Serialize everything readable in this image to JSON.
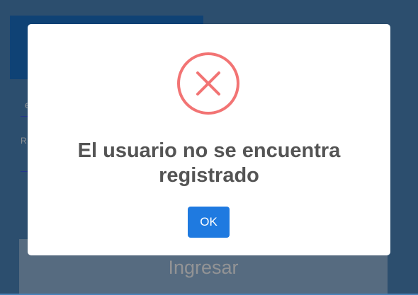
{
  "background_form": {
    "field1_partial_text": "e",
    "field2_partial_label": "R",
    "submit_label": "Ingresar"
  },
  "dialog": {
    "icon": "error-x-circle-icon",
    "icon_color": "#f27474",
    "title": "El usuario no se encuentra registrado",
    "ok_label": "OK",
    "ok_color": "#1f7ae0"
  }
}
